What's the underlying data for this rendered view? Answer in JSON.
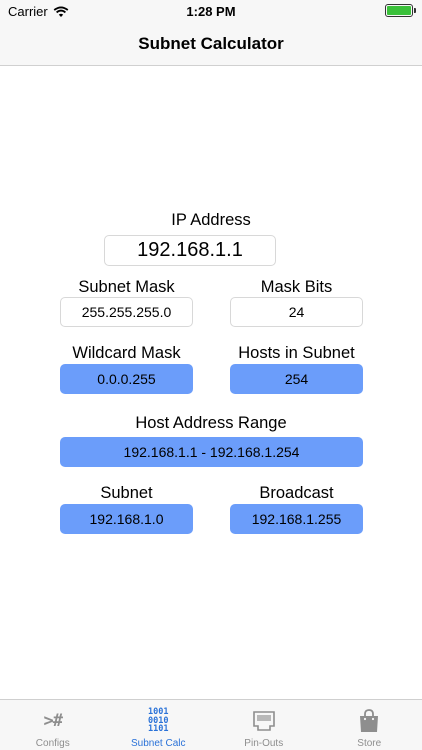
{
  "status_bar": {
    "carrier": "Carrier",
    "time": "1:28 PM",
    "battery_level": 1.0
  },
  "nav": {
    "title": "Subnet Calculator"
  },
  "ip": {
    "label": "IP Address",
    "value": "192.168.1.1"
  },
  "mask": {
    "label": "Subnet Mask",
    "value": "255.255.255.0"
  },
  "bits": {
    "label": "Mask Bits",
    "value": "24"
  },
  "wildcard": {
    "label": "Wildcard Mask",
    "value": "0.0.0.255"
  },
  "hosts": {
    "label": "Hosts in Subnet",
    "value": "254"
  },
  "range": {
    "label": "Host Address Range",
    "value": "192.168.1.1 - 192.168.1.254"
  },
  "subnet": {
    "label": "Subnet",
    "value": "192.168.1.0"
  },
  "broadcast": {
    "label": "Broadcast",
    "value": "192.168.1.255"
  },
  "tabs": [
    {
      "label": "Configs",
      "icon": "terminal-hash-icon",
      "icon_text": ">#"
    },
    {
      "label": "Subnet Calc",
      "icon": "binary-icon",
      "icon_lines": [
        "1001",
        "0010",
        "1101"
      ]
    },
    {
      "label": "Pin-Outs",
      "icon": "ethernet-port-icon"
    },
    {
      "label": "Store",
      "icon": "shopping-bag-icon"
    }
  ],
  "colors": {
    "accent": "#2a72d8",
    "result_bg": "#6b9dfa",
    "battery": "#3bc13b"
  }
}
